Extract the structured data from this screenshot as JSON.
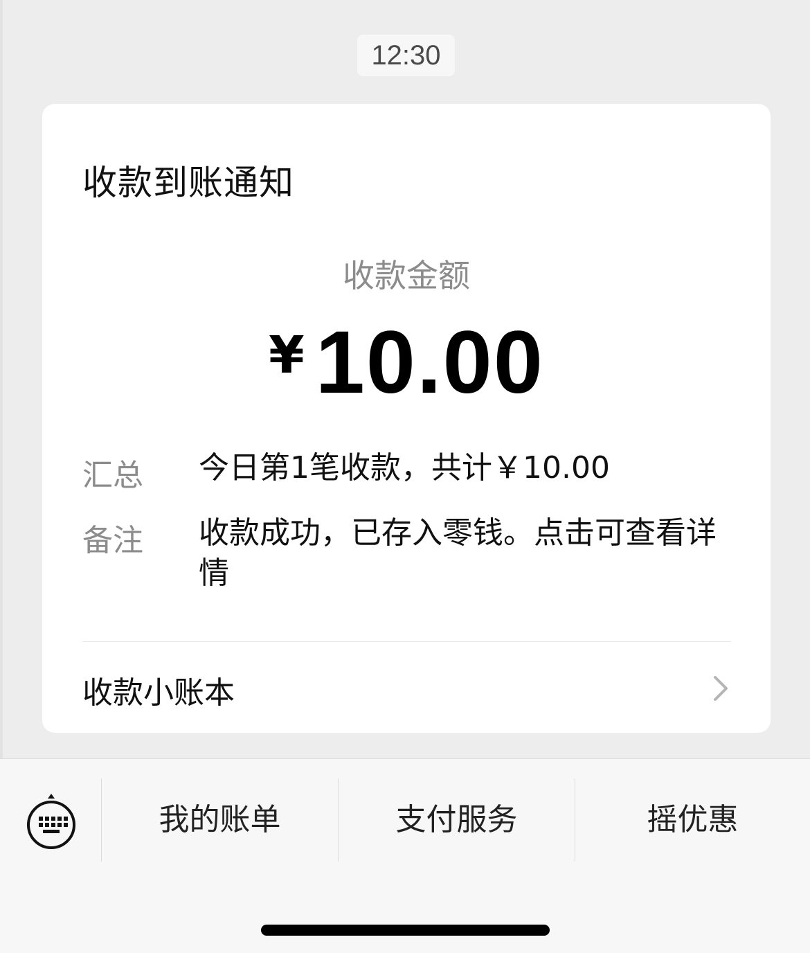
{
  "chat": {
    "timestamp": "12:30"
  },
  "card": {
    "title": "收款到账通知",
    "amount_label": "收款金额",
    "currency_symbol": "¥",
    "amount": "10.00",
    "rows": [
      {
        "label": "汇总",
        "value": "今日第1笔收款，共计￥10.00"
      },
      {
        "label": "备注",
        "value": "收款成功，已存入零钱。点击可查看详情"
      }
    ],
    "ledger_label": "收款小账本",
    "ledger_icon": "chevron-right-icon"
  },
  "bottom_menu": {
    "keyboard_icon": "keyboard-icon",
    "items": [
      {
        "label": "我的账单"
      },
      {
        "label": "支付服务"
      },
      {
        "label": "摇优惠"
      }
    ]
  },
  "colors": {
    "background": "#ededed",
    "card": "#ffffff",
    "muted_text": "#8c8c8c",
    "primary_text": "#111111"
  }
}
